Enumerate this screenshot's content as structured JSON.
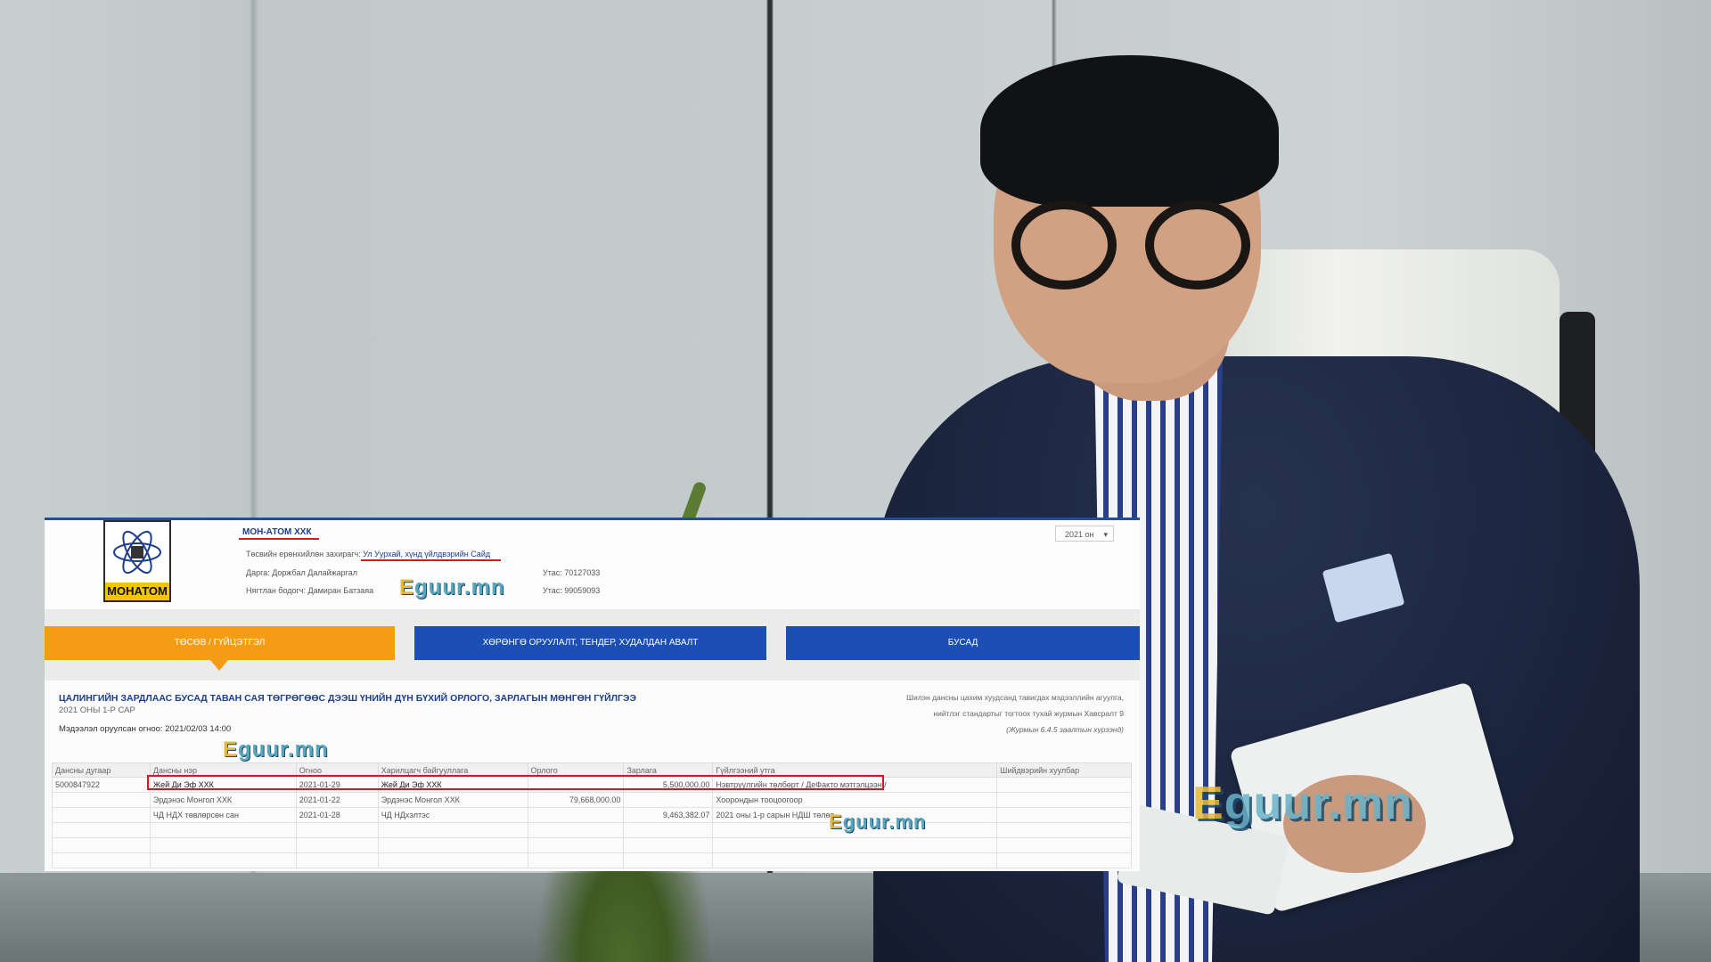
{
  "watermark": {
    "brand_e": "E",
    "brand_rest": "guur.mn"
  },
  "company": {
    "name": "МОН-АТОМ ХХК",
    "logo_text": "МОНАТОМ",
    "manager_label": "Төсвийн ерөнхийлөн захирагч: ",
    "manager_value": "Ул Уурхай, хүнд үйлдвэрийн Сайд",
    "director": "Дарга: Доржбал Далайжаргал",
    "accountant": "Нягтлан бодогч: Дамиран Батзаяа",
    "phone1": "Утас: 70127033",
    "phone2": "Утас: 99059093",
    "year_select": "2021 он"
  },
  "tabs": [
    {
      "label": "ТӨСӨВ / ГҮЙЦЭТГЭЛ"
    },
    {
      "label": "ХӨРӨНГӨ ОРУУЛАЛТ, ТЕНДЕР, ХУДАЛДАН АВАЛТ"
    },
    {
      "label": "БУСАД"
    }
  ],
  "report": {
    "title": "ЦАЛИНГИЙН ЗАРДЛААС БУСАД ТАВАН САЯ ТӨГРӨГӨӨС ДЭЭШ ҮНИЙН ДҮН БҮХИЙ ОРЛОГО, ЗАРЛАГЫН МӨНГӨН ГҮЙЛГЭЭ",
    "period": "2021 ОНЫ 1-Р САР",
    "uploaded": "Мэдээлэл оруулсан огноо: 2021/02/03 14:00",
    "note1": "Шилэн дансны цахим хуудсанд тавигдах мэдээллийн агуулга,",
    "note2": "нийтлэг стандартыг тогтоох тухай журмын Хавсралт 9",
    "note3": "(Журмын 6.4.5 заалтын хүрээнд)"
  },
  "table": {
    "headers": [
      "Дансны дугаар",
      "Дансны нэр",
      "Огноо",
      "Харилцагч байгууллага",
      "Орлого",
      "Зарлага",
      "Гүйлгээний утга",
      "Шийдвэрийн хуулбар"
    ],
    "rows": [
      [
        "5000847922",
        "Жей Ди Эф ХХК",
        "2021-01-29",
        "Жей Ди Эф ХХК",
        "",
        "5,500,000.00",
        "Нэвтрүүлгийн төлбөрт / ДеФакто мэтгэлцээн /",
        ""
      ],
      [
        "",
        "Эрдэнэс Монгол ХХК",
        "2021-01-22",
        "Эрдэнэс Монгол ХХК",
        "79,668,000.00",
        "",
        "Хоорондын тооцоогоор",
        ""
      ],
      [
        "",
        "ЧД НДХ төвлөрсөн сан",
        "2021-01-28",
        "ЧД НДхэлтэс",
        "",
        "9,463,382.07",
        "2021 оны 1-р сарын НДШ төлөв",
        ""
      ],
      [
        "",
        "",
        "",
        "",
        "",
        "",
        "",
        ""
      ],
      [
        "",
        "",
        "",
        "",
        "",
        "",
        "",
        ""
      ],
      [
        "",
        "",
        "",
        "",
        "",
        "",
        "",
        ""
      ]
    ]
  },
  "colors": {
    "orange_tab": "#f59c14",
    "blue_tab": "#1c4fb6",
    "highlight": "#d21c1c"
  }
}
